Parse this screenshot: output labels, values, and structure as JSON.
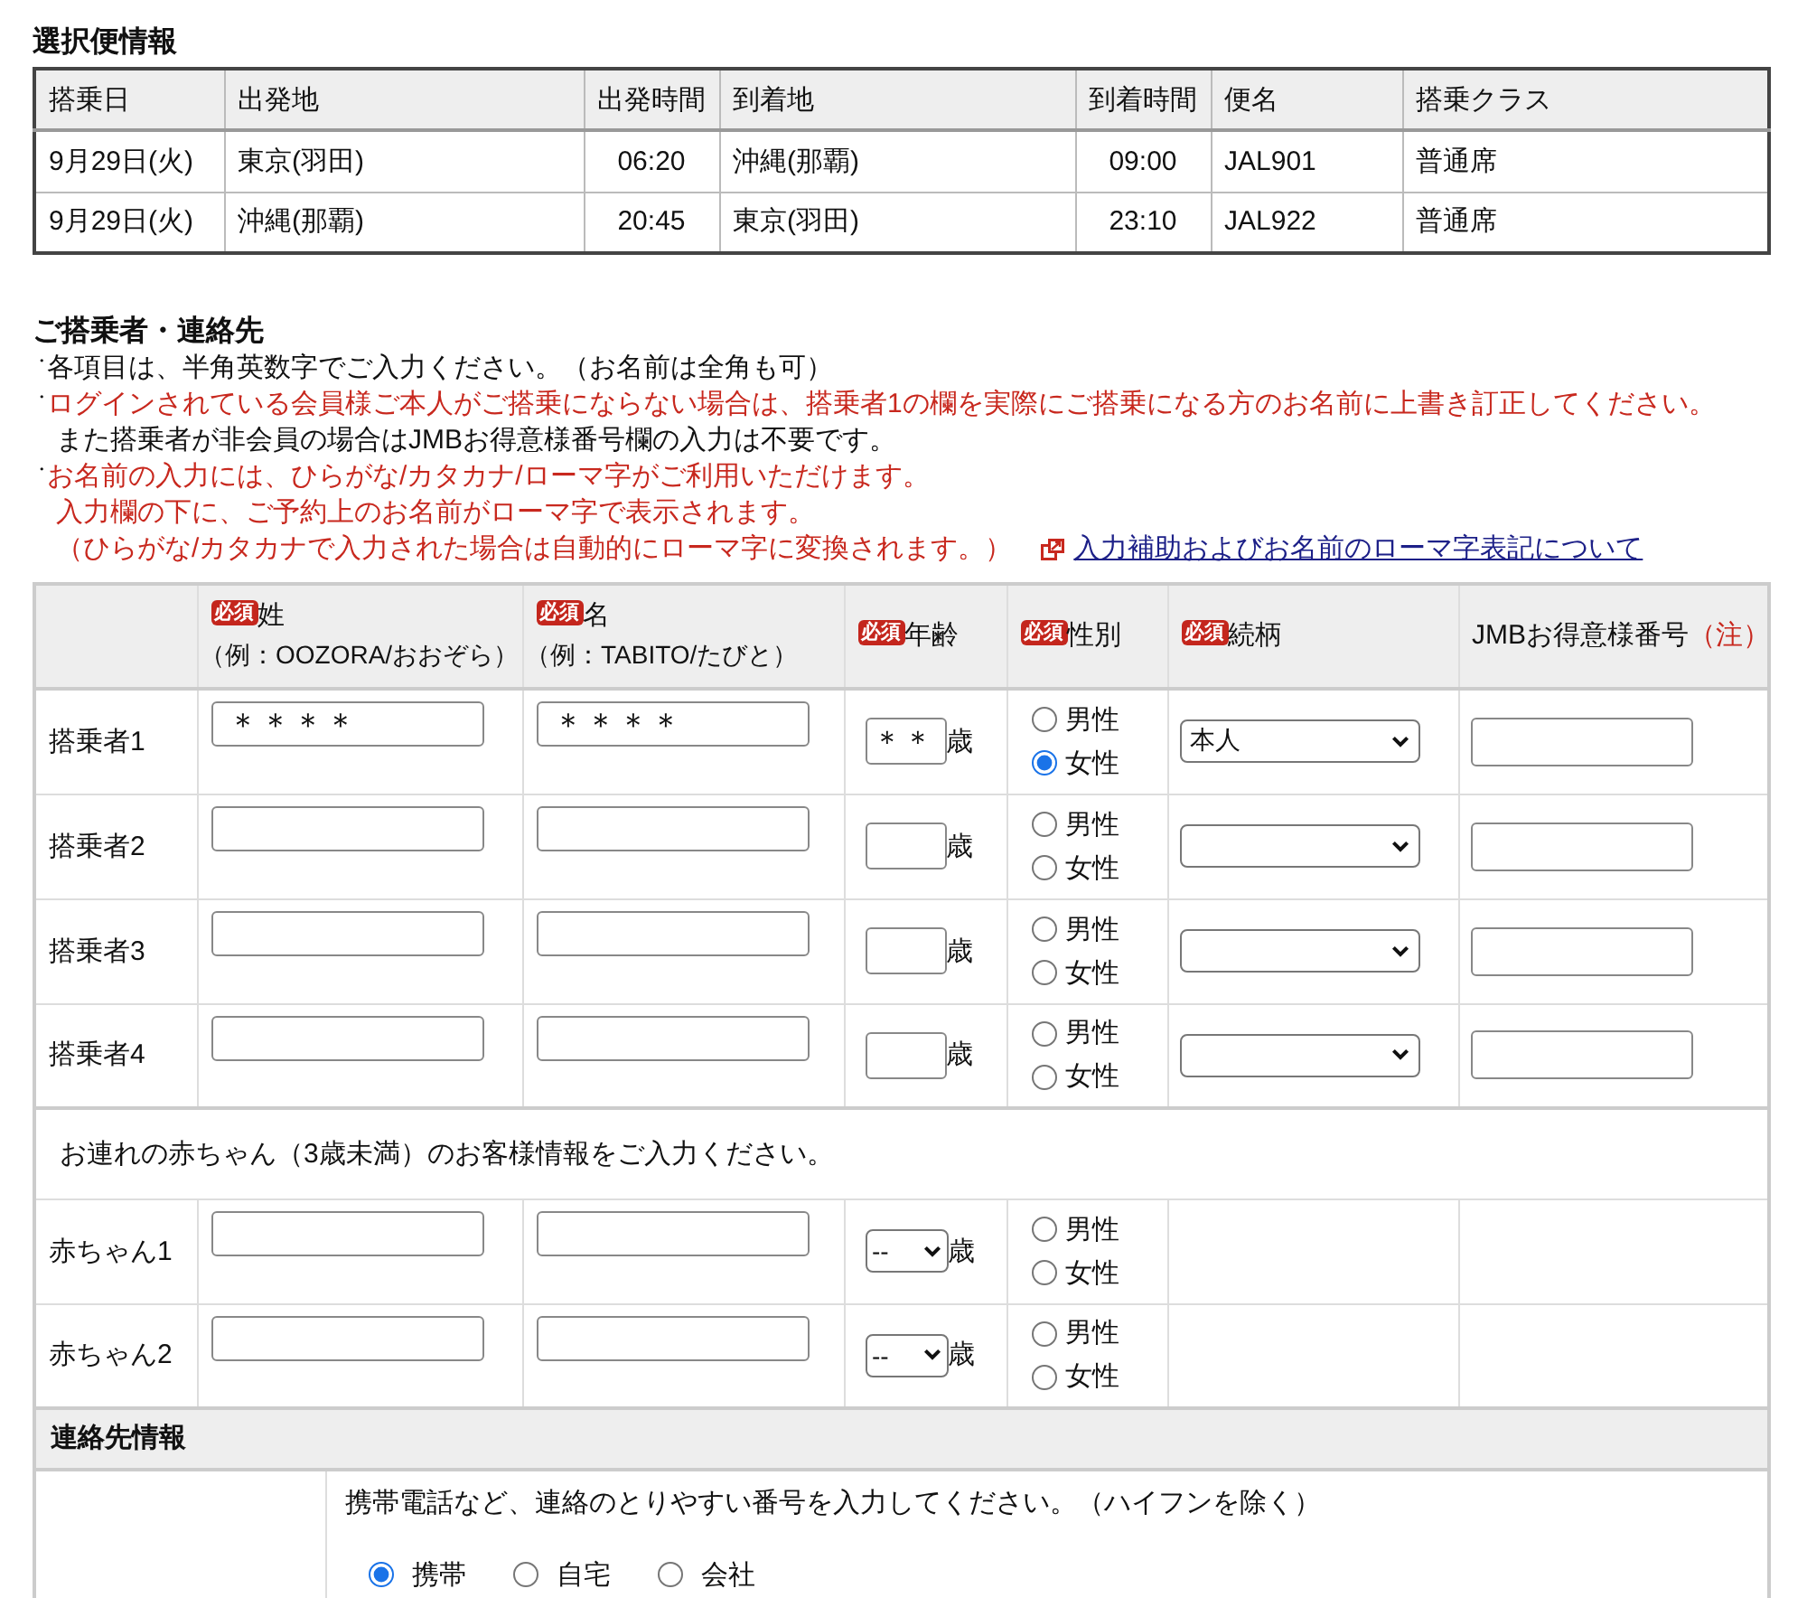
{
  "flight_info": {
    "title": "選択便情報",
    "columns": [
      "搭乗日",
      "出発地",
      "出発時間",
      "到着地",
      "到着時間",
      "便名",
      "搭乗クラス"
    ],
    "rows": [
      [
        "9月29日(火)",
        "東京(羽田)",
        "06:20",
        "沖縄(那覇)",
        "09:00",
        "JAL901",
        "普通席"
      ],
      [
        "9月29日(火)",
        "沖縄(那覇)",
        "20:45",
        "東京(羽田)",
        "23:10",
        "JAL922",
        "普通席"
      ]
    ]
  },
  "passenger_details": {
    "title": "ご搭乗者・連絡先",
    "notes": [
      {
        "bullet": "・",
        "lines": [
          {
            "kind": "plain",
            "text": "各項目は、半角英数字でご入力ください。（お名前は全角も可）"
          }
        ]
      },
      {
        "bullet": "・",
        "lines": [
          {
            "kind": "alert",
            "text": "ログインされている会員様ご本人がご搭乗にならない場合は、搭乗者1の欄を実際にご搭乗になる方のお名前に上書き訂正してください。"
          },
          {
            "kind": "plain",
            "text": "また搭乗者が非会員の場合はJMBお得意様番号欄の入力は不要です。"
          }
        ]
      },
      {
        "bullet": "・",
        "lines": [
          {
            "kind": "alert",
            "text": "お名前の入力には、ひらがな/カタカナ/ローマ字がご利用いただけます。"
          },
          {
            "kind": "alert",
            "text": "入力欄の下に、ご予約上のお名前がローマ字で表示されます。"
          },
          {
            "kind": "alert",
            "text": "（ひらがな/カタカナで入力された場合は自動的にローマ字に変換されます。）"
          }
        ],
        "link": {
          "label": "入力補助およびお名前のローマ字表記について"
        }
      }
    ]
  },
  "passenger_table": {
    "columns": [
      {
        "badge": "必須",
        "label": "姓",
        "example": "（例：OOZORA/おおぞら）"
      },
      {
        "badge": "必須",
        "label": "名",
        "example": "（例：TABITO/たびと）"
      },
      {
        "badge": "必須",
        "label": "年齢"
      },
      {
        "badge": "必須",
        "label": "性別"
      },
      {
        "badge": "必須",
        "label": "続柄"
      },
      {
        "label": "JMBお得意様番号",
        "note": "（注）"
      }
    ],
    "passengers": [
      {
        "label": "搭乗者1",
        "surname": "＊＊＊＊",
        "given_name": "＊＊＊＊",
        "age": "＊＊",
        "age_unit": "歳",
        "genders": [
          {
            "label": "男性",
            "selected": false
          },
          {
            "label": "女性",
            "selected": true
          }
        ],
        "relation": "本人"
      },
      {
        "label": "搭乗者2",
        "age_unit": "歳",
        "genders": [
          {
            "label": "男性",
            "selected": false
          },
          {
            "label": "女性",
            "selected": false
          }
        ]
      },
      {
        "label": "搭乗者3",
        "age_unit": "歳",
        "genders": [
          {
            "label": "男性",
            "selected": false
          },
          {
            "label": "女性",
            "selected": false
          }
        ]
      },
      {
        "label": "搭乗者4",
        "age_unit": "歳",
        "genders": [
          {
            "label": "男性",
            "selected": false
          },
          {
            "label": "女性",
            "selected": false
          }
        ]
      }
    ],
    "infant_note": "お連れの赤ちゃん（3歳未満）のお客様情報をご入力ください。",
    "infants": [
      {
        "label": "赤ちゃん1",
        "age": "--",
        "age_unit": "歳",
        "genders": [
          {
            "label": "男性",
            "selected": false
          },
          {
            "label": "女性",
            "selected": false
          }
        ]
      },
      {
        "label": "赤ちゃん2",
        "age": "--",
        "age_unit": "歳",
        "genders": [
          {
            "label": "男性",
            "selected": false
          },
          {
            "label": "女性",
            "selected": false
          }
        ]
      }
    ]
  },
  "contact": {
    "title": "連絡先情報",
    "instruction": "携帯電話など、連絡のとりやすい番号を入力してください。（ハイフンを除く）",
    "phone_types": [
      {
        "label": "携帯",
        "selected": true
      },
      {
        "label": "自宅",
        "selected": false
      },
      {
        "label": "会社",
        "selected": false
      }
    ]
  }
}
